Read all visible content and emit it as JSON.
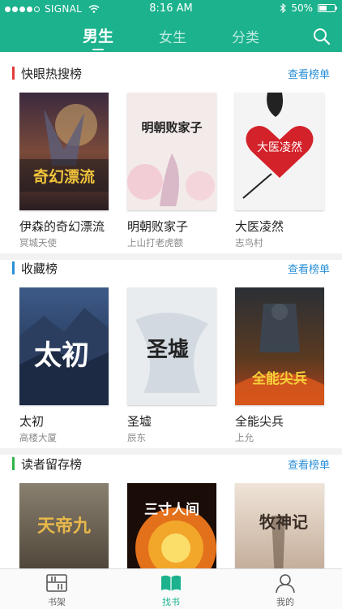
{
  "status_bar": {
    "carrier": "SIGNAL",
    "time": "8:16 AM",
    "battery": "50%",
    "battery_level": 0.5
  },
  "header": {
    "tabs": [
      {
        "label": "男生",
        "active": true
      },
      {
        "label": "女生"
      },
      {
        "label": "分类"
      }
    ],
    "accent_color": "#1bb28d"
  },
  "sections": [
    {
      "title": "快眼热搜榜",
      "more_label": "查看榜单",
      "bar_color": "#e23b3b",
      "books": [
        {
          "title": "伊森的奇幻漂流",
          "author": "冥城天使",
          "cover_text": "奇幻漂流"
        },
        {
          "title": "明朝败家子",
          "author": "上山打老虎额",
          "cover_text": "明朝败家子"
        },
        {
          "title": "大医凌然",
          "author": "志鸟村",
          "cover_text": "大医凌然"
        }
      ]
    },
    {
      "title": "收藏榜",
      "more_label": "查看榜单",
      "bar_color": "#2a8fd8",
      "books": [
        {
          "title": "太初",
          "author": "高楼大厦",
          "cover_text": "太初"
        },
        {
          "title": "圣墟",
          "author": "辰东",
          "cover_text": "圣墟"
        },
        {
          "title": "全能尖兵",
          "author": "上允",
          "cover_text": "全能尖兵"
        }
      ]
    },
    {
      "title": "读者留存榜",
      "more_label": "查看榜单",
      "bar_color": "#2fb24a",
      "books": [
        {
          "title": "",
          "author": "",
          "cover_text": "天帝九"
        },
        {
          "title": "",
          "author": "",
          "cover_text": "三寸人间"
        },
        {
          "title": "",
          "author": "",
          "cover_text": "牧神记"
        }
      ]
    }
  ],
  "bottom_nav": [
    {
      "label": "书架",
      "icon": "bookshelf-icon"
    },
    {
      "label": "找书",
      "icon": "open-book-icon",
      "active": true
    },
    {
      "label": "我的",
      "icon": "person-icon"
    }
  ]
}
